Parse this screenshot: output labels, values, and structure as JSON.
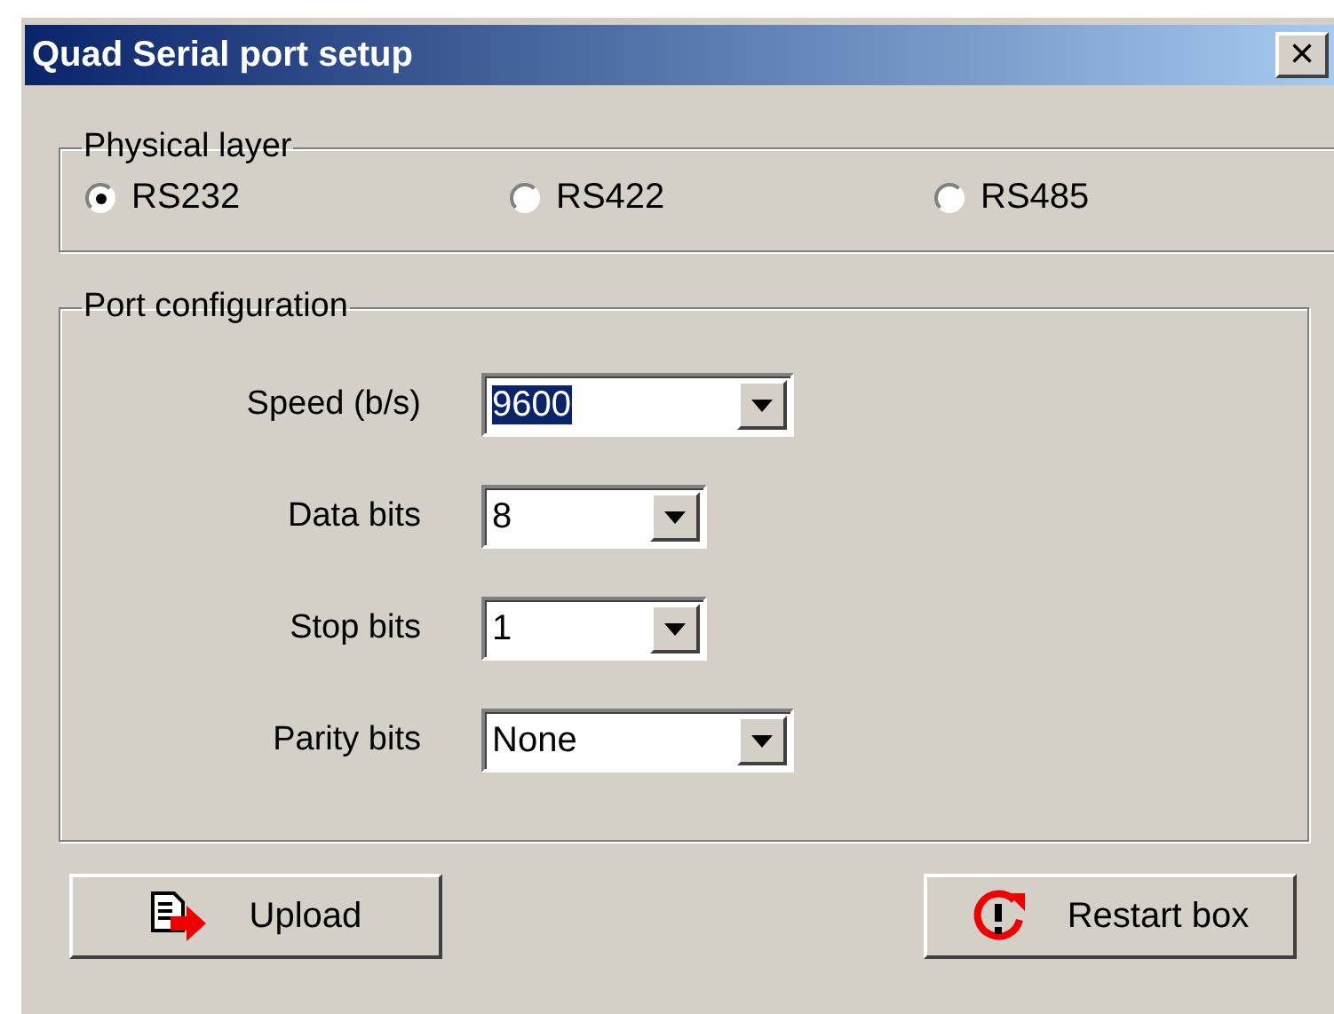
{
  "window": {
    "title": "Quad Serial port setup",
    "close": "×"
  },
  "physical_layer": {
    "title": "Physical layer",
    "options": [
      {
        "label": "RS232",
        "selected": true
      },
      {
        "label": "RS422",
        "selected": false
      },
      {
        "label": "RS485",
        "selected": false
      }
    ]
  },
  "port_configuration": {
    "title": "Port configuration",
    "fields": [
      {
        "label": "Speed (b/s)",
        "value": "9600",
        "text_selected": true,
        "kind": "wide"
      },
      {
        "label": "Data bits",
        "value": "8",
        "text_selected": false,
        "kind": "narrow"
      },
      {
        "label": "Stop bits",
        "value": "1",
        "text_selected": false,
        "kind": "narrow"
      },
      {
        "label": "Parity bits",
        "value": "None",
        "text_selected": false,
        "kind": "wide"
      }
    ]
  },
  "buttons": [
    {
      "label": "Upload",
      "kind": "upload"
    },
    {
      "label": "Restart box",
      "kind": "restart"
    }
  ]
}
